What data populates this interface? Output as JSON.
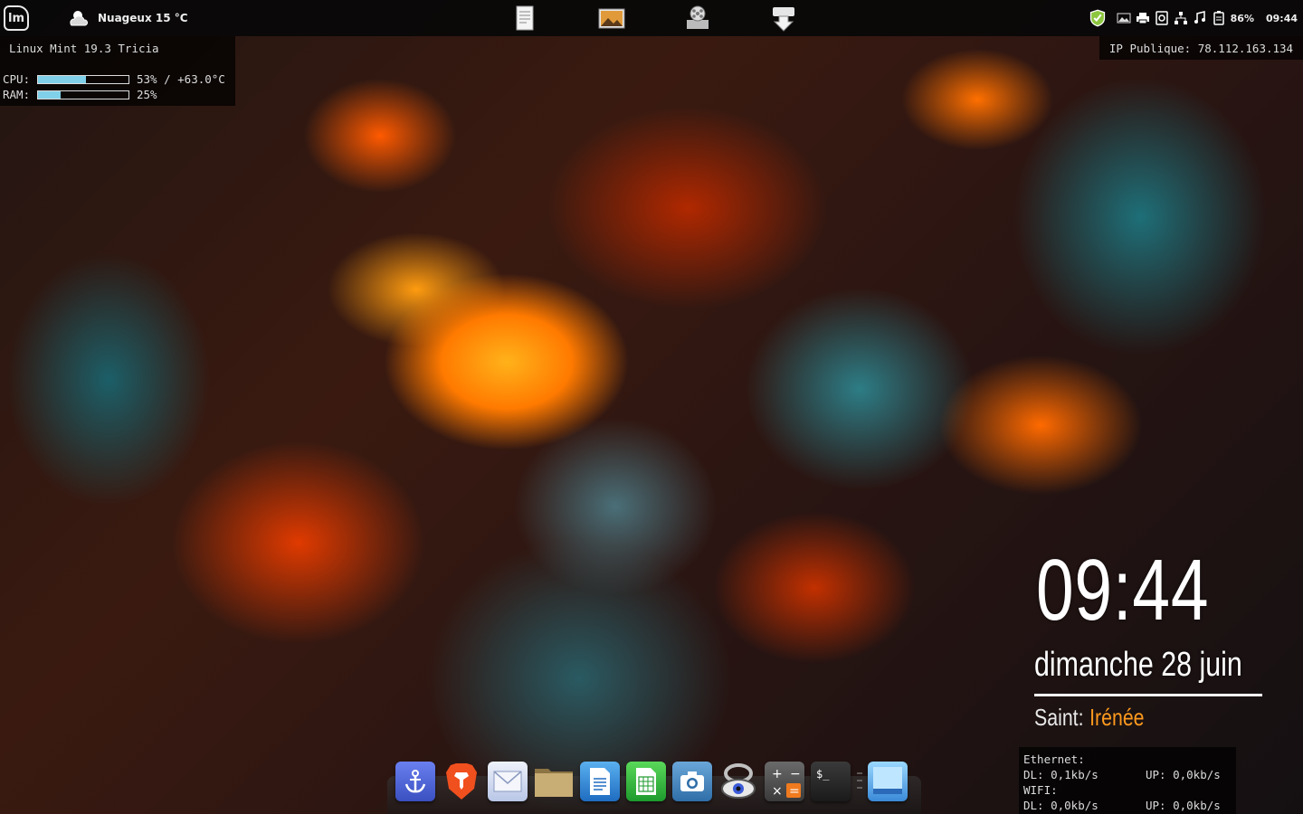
{
  "top_panel": {
    "weather": {
      "text": "Nuageux 15 °C",
      "icon": "cloud-icon"
    },
    "launchers": [
      {
        "name": "text-editor-launcher",
        "icon": "document-icon"
      },
      {
        "name": "image-viewer-launcher",
        "icon": "picture-icon"
      },
      {
        "name": "video-player-launcher",
        "icon": "film-reel-icon"
      },
      {
        "name": "software-manager-launcher",
        "icon": "download-icon"
      }
    ],
    "tray": {
      "battery": "86%",
      "time": "09:44"
    }
  },
  "sysinfo": {
    "os": "Linux Mint 19.3 Tricia",
    "cpu": {
      "label": "CPU:",
      "value": "53% / +63.0°C",
      "percent": 53
    },
    "ram": {
      "label": "RAM:",
      "value": "25%",
      "percent": 25
    }
  },
  "ip": {
    "text": "IP Publique: 78.112.163.134"
  },
  "clock": {
    "time": "09:44",
    "date": "dimanche 28 juin",
    "saint_label": "Saint:",
    "saint_name": "Irénée"
  },
  "network": {
    "ethernet_label": "Ethernet:",
    "eth_dl": "DL: 0,1kb/s",
    "eth_up": "UP: 0,0kb/s",
    "wifi_label": "WIFI:",
    "wifi_dl": "DL: 0,0kb/s",
    "wifi_up": "UP: 0,0kb/s"
  },
  "dock": [
    {
      "icon": "anchor-icon",
      "color": "#4a5fd0"
    },
    {
      "icon": "brave-lion-icon",
      "color": "#f04a1e"
    },
    {
      "icon": "mail-icon",
      "color": "#c8d4ee"
    },
    {
      "icon": "folder-icon",
      "color": "#b89a5a"
    },
    {
      "icon": "writer-document-icon",
      "color": "#2a7fd0"
    },
    {
      "icon": "calc-spreadsheet-icon",
      "color": "#2aa83a"
    },
    {
      "icon": "camera-icon",
      "color": "#3a7ab8"
    },
    {
      "icon": "eye-icon",
      "color": "#444444"
    },
    {
      "icon": "calculator-icon",
      "color": "#555555"
    },
    {
      "icon": "terminal-icon",
      "color": "#2a2a2a"
    },
    {
      "icon": "window-icon",
      "color": "#4aa8e8"
    }
  ]
}
